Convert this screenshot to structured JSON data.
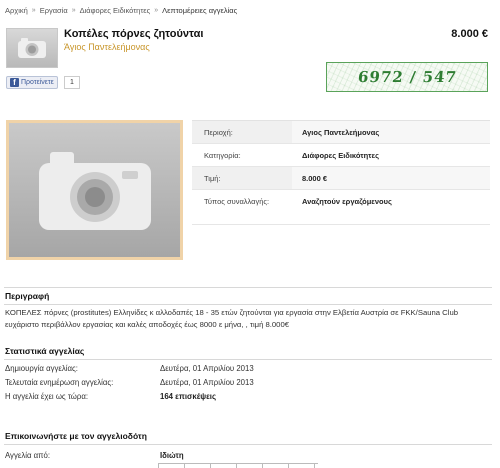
{
  "breadcrumb": {
    "items": [
      "Αρχική",
      "Εργασία",
      "Διάφορες Ειδικότητες"
    ],
    "current": "Λεπτομέρειες αγγελίας",
    "separator": "»"
  },
  "ad": {
    "title": "Κοπέλες πόρνες ζητούνται",
    "location": "Άγιος Παντελεήμονας",
    "price": "8.000 €",
    "phone": "6972 / 547"
  },
  "social": {
    "recommend_label": "Προτείνετε",
    "fb_icon_letter": "f",
    "count": "1"
  },
  "details": [
    {
      "label": "Περιοχή:",
      "value": "Αγιος Παντελεήμονας"
    },
    {
      "label": "Κατηγορία:",
      "value": "Διάφορες Ειδικότητες"
    },
    {
      "label": "Τιμή:",
      "value": "8.000 €"
    },
    {
      "label": "Τύπος συναλλαγής:",
      "value": "Αναζητούν εργαζόμενους"
    }
  ],
  "description": {
    "title": "Περιγραφή",
    "text": "ΚΟΠΕΛΕΣ πόρνες (prostitutes) Ελληνίδες κ αλλοδαπές 18 - 35 ετών ζητούνται για εργασία στην Ελβετία Αυστρία σε FKK/Sauna Club ευχάριστο περιβάλλον εργασίας και καλές αποδοχές έως 8000 ε μήνα, , τιμή 8.000€"
  },
  "stats": {
    "title": "Στατιστικά αγγελίας",
    "rows": [
      {
        "label": "Δημιουργία αγγελίας:",
        "value": "Δευτέρα, 01 Απριλίου 2013"
      },
      {
        "label": "Τελευταία ενημέρωση αγγελίας:",
        "value": "Δευτέρα, 01 Απριλίου 2013"
      },
      {
        "label": "Η αγγελία έχει ως τώρα:",
        "value": "164 επισκέψεις"
      }
    ]
  },
  "contact": {
    "title": "Επικοινωνήστε με τον αγγελιοδότη",
    "from_label": "Αγγελία από:",
    "from_value": "Ιδιώτη"
  },
  "colors": {
    "location": "#c8962b",
    "phone": "#2e7d32",
    "photo_frame": "#f0d3a8",
    "facebook": "#3b5998"
  },
  "icons": {
    "thumbnail": "camera-icon",
    "photo": "camera-icon",
    "facebook": "facebook-icon"
  }
}
